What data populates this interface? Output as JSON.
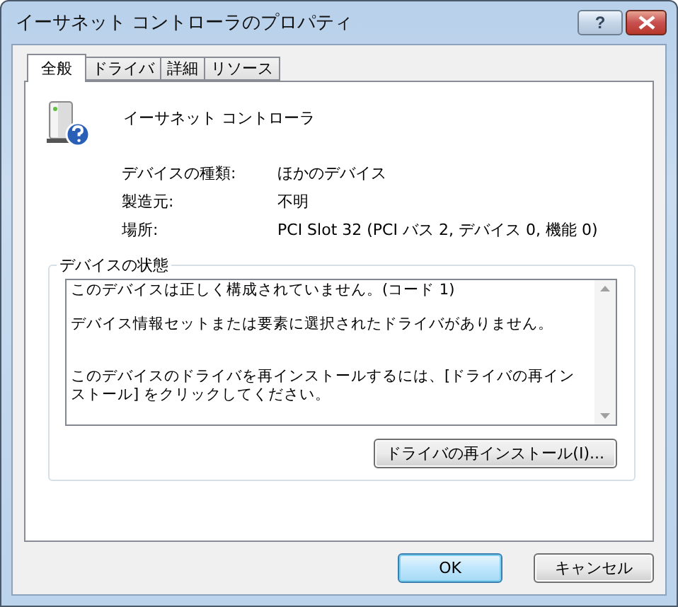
{
  "window": {
    "title": "イーサネット コントローラのプロパティ",
    "help_button": "?"
  },
  "tabs": [
    {
      "label": "全般",
      "selected": true
    },
    {
      "label": "ドライバ",
      "selected": false
    },
    {
      "label": "詳細",
      "selected": false
    },
    {
      "label": "リソース",
      "selected": false
    }
  ],
  "device_name": "イーサネット コントローラ",
  "properties": [
    {
      "label": "デバイスの種類:",
      "value": "ほかのデバイス"
    },
    {
      "label": "製造元:",
      "value": "不明"
    },
    {
      "label": "場所:",
      "value": "PCI Slot 32 (PCI バス 2, デバイス 0, 機能 0)"
    }
  ],
  "status_group": {
    "title": "デバイスの状態",
    "paragraphs": [
      "このデバイスは正しく構成されていません。(コード 1)",
      "デバイス情報セットまたは要素に選択されたドライバがありません。",
      "このデバイスのドライバを再インストールするには、[ドライバの再インストール] をクリックしてください。"
    ],
    "button": "ドライバの再インストール(I)..."
  },
  "buttons": [
    {
      "label": "OK",
      "default": true
    },
    {
      "label": "キャンセル",
      "default": false
    }
  ]
}
